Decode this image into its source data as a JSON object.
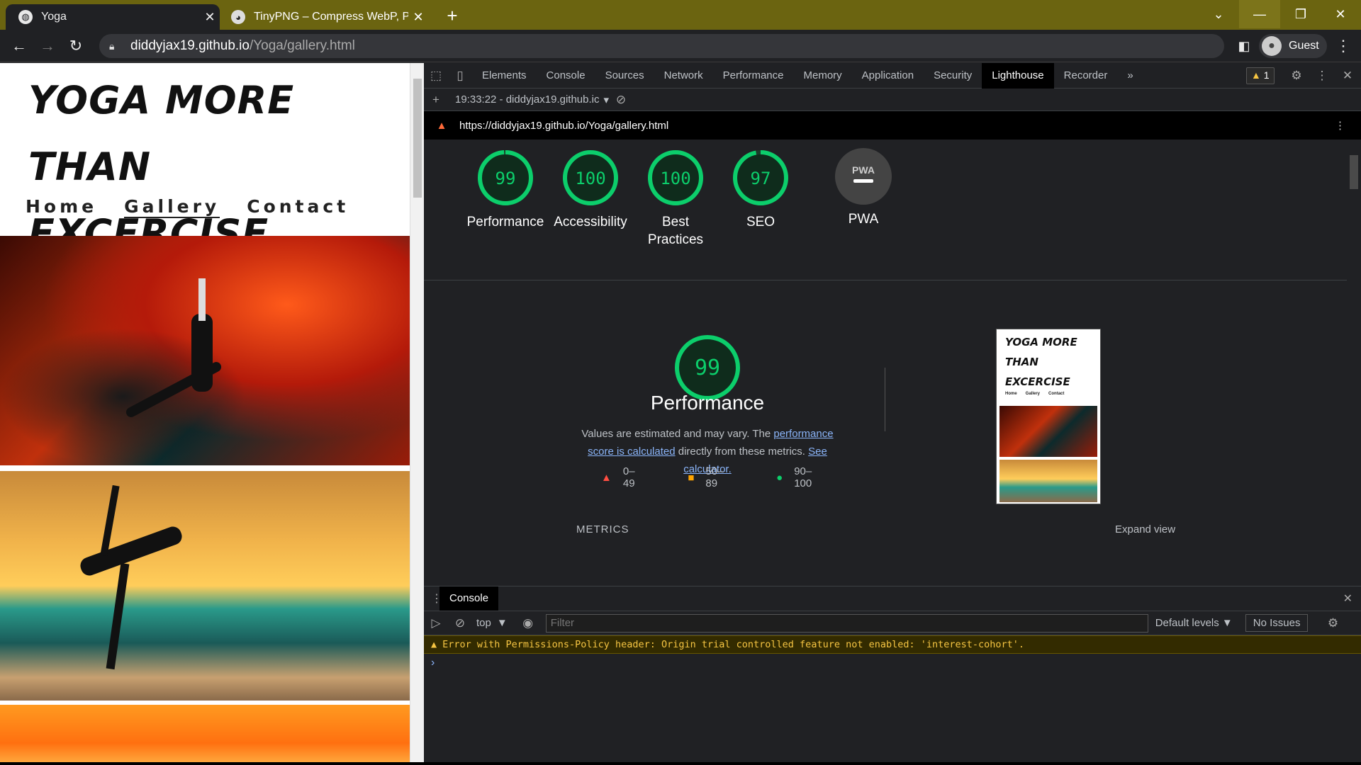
{
  "browser": {
    "tabs": [
      {
        "title": "Yoga",
        "close": "✕"
      },
      {
        "title": "TinyPNG – Compress WebP, PNG",
        "close": "✕"
      }
    ],
    "new_tab": "+",
    "address": {
      "host": "diddyjax19.github.io",
      "path": "/Yoga/gallery.html"
    },
    "profile": "Guest",
    "window_controls": {
      "minimize": "—",
      "restore": "❐",
      "close": "✕",
      "tab_search": "⌄"
    }
  },
  "site": {
    "title_line1": "YOGA MORE THAN",
    "title_line2": "EXCERCISE",
    "nav": [
      "Home",
      "Gallery",
      "Contact"
    ],
    "current_nav": "Gallery"
  },
  "devtools": {
    "tabs": [
      "Elements",
      "Console",
      "Sources",
      "Network",
      "Performance",
      "Memory",
      "Application",
      "Security",
      "Lighthouse",
      "Recorder"
    ],
    "selected_tab": "Lighthouse",
    "more_tabs": "»",
    "warning_count": "1",
    "lighthouse": {
      "report_selector": "19:33:22 - diddyjax19.github.ic",
      "url": "https://diddyjax19.github.io/Yoga/gallery.html",
      "scores": [
        {
          "label": "Performance",
          "value": 99
        },
        {
          "label": "Accessibility",
          "value": 100
        },
        {
          "label": "Best Practices",
          "value": 100
        },
        {
          "label": "SEO",
          "value": 97
        }
      ],
      "pwa_label": "PWA",
      "pwa_badge": "PWA",
      "perf_score": 99,
      "perf_title": "Performance",
      "perf_desc_1": "Values are estimated and may vary. The ",
      "perf_desc_link1": "performance score is calculated",
      "perf_desc_2": " directly from these metrics. ",
      "perf_desc_link2": "See calculator.",
      "legend": [
        "0–49",
        "50–89",
        "90–100"
      ],
      "thumbnail": {
        "title": "YOGA MORE THAN EXCERCISE",
        "nav": [
          "Home",
          "Gallery",
          "Contact"
        ]
      },
      "metrics_label": "METRICS",
      "expand_label": "Expand view",
      "colors": {
        "pass": "#0cce6b",
        "average": "#ffa400",
        "fail": "#ff4e42"
      }
    },
    "console": {
      "tab": "Console",
      "context": "top",
      "filter_placeholder": "Filter",
      "levels": "Default levels ▼",
      "issues": "No Issues",
      "error": "Error with Permissions-Policy header: Origin trial controlled feature not enabled: 'interest-cohort'.",
      "prompt": "›"
    }
  }
}
